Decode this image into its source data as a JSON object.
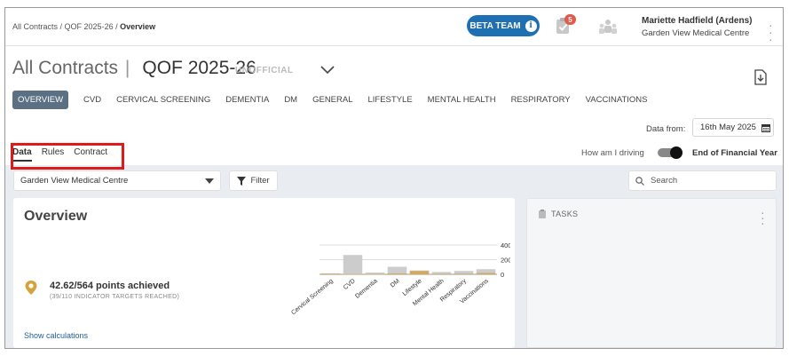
{
  "breadcrumb": {
    "part1": "All Contracts",
    "sep1": " / ",
    "part2": "QOF 2025-26",
    "sep2": " / ",
    "current": "Overview"
  },
  "header": {
    "beta_label": "BETA TEAM",
    "notif_count": "5",
    "user_name": "Mariette Hadfield (Ardens)",
    "user_org": "Garden View Medical Centre",
    "beta_color": "#1f6fb3",
    "badge_color": "#e05a4c"
  },
  "title": {
    "all_contracts": "All Contracts",
    "separator": "|",
    "contract": "QOF 2025-26",
    "status": "UNOFFICIAL"
  },
  "tabs": [
    {
      "label": "OVERVIEW",
      "active": true
    },
    {
      "label": "CVD"
    },
    {
      "label": "CERVICAL SCREENING"
    },
    {
      "label": "DEMENTIA"
    },
    {
      "label": "DM"
    },
    {
      "label": "GENERAL"
    },
    {
      "label": "LIFESTYLE"
    },
    {
      "label": "MENTAL HEALTH"
    },
    {
      "label": "RESPIRATORY"
    },
    {
      "label": "VACCINATIONS"
    }
  ],
  "data_from": {
    "label": "Data from:",
    "value": "16th May 2025"
  },
  "subtabs": [
    {
      "label": "Data",
      "active": true
    },
    {
      "label": "Rules"
    },
    {
      "label": "Contract"
    }
  ],
  "driving": {
    "label": "How am I driving",
    "mode": "End of Financial Year",
    "toggle_on": true
  },
  "filters": {
    "practice": "Garden View Medical Centre",
    "filter_label": "Filter",
    "search_placeholder": "Search"
  },
  "overview": {
    "title": "Overview",
    "points": "42.62/564 points achieved",
    "targets": "(39/110 INDICATOR TARGETS REACHED)",
    "show_calculations": "Show calculations"
  },
  "chart_data": {
    "type": "bar",
    "categories": [
      "Cervical Screening",
      "CVD",
      "Dementia",
      "DM",
      "Lifestyle",
      "Mental Health",
      "Respiratory",
      "Vaccinations"
    ],
    "series": [
      {
        "values": [
          14,
          264,
          24,
          103,
          53,
          32,
          46,
          70
        ],
        "color": "#cccccc"
      },
      {
        "values": [
          8,
          4,
          3,
          12,
          45,
          6,
          8,
          18
        ],
        "color": "#d6a857"
      }
    ],
    "y_ticks": [
      "400",
      "200",
      "0"
    ],
    "ylim": [
      0,
      400
    ]
  },
  "tasks": {
    "title": "TASKS"
  }
}
